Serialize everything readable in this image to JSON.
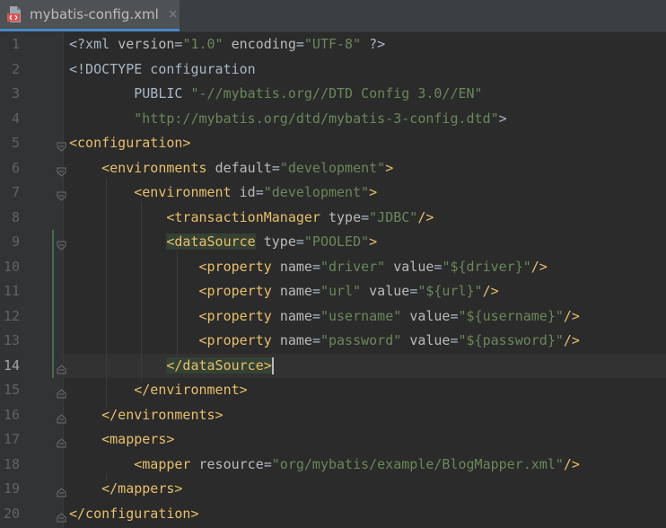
{
  "tab": {
    "title": "mybatis-config.xml",
    "close": "×"
  },
  "editor": {
    "current_line": 14,
    "lines": [
      {
        "n": "1",
        "t": [
          [
            "txt",
            "<?xml "
          ],
          [
            "attr",
            "version"
          ],
          [
            "txt",
            "="
          ],
          [
            "val",
            "\"1.0\""
          ],
          [
            "txt",
            " "
          ],
          [
            "attr",
            "encoding"
          ],
          [
            "txt",
            "="
          ],
          [
            "val",
            "\"UTF-8\""
          ],
          [
            "txt",
            " ?>"
          ]
        ]
      },
      {
        "n": "2",
        "t": [
          [
            "txt",
            "<!DOCTYPE configuration"
          ]
        ]
      },
      {
        "n": "3",
        "t": [
          [
            "txt",
            "        PUBLIC "
          ],
          [
            "val",
            "\"-//mybatis.org//DTD Config 3.0//EN\""
          ]
        ]
      },
      {
        "n": "4",
        "t": [
          [
            "txt",
            "        "
          ],
          [
            "val",
            "\"http://mybatis.org/dtd/mybatis-3-config.dtd\""
          ],
          [
            "txt",
            ">"
          ]
        ]
      },
      {
        "n": "5",
        "t": [
          [
            "tag",
            "<configuration>"
          ]
        ]
      },
      {
        "n": "6",
        "t": [
          [
            "txt",
            "    "
          ],
          [
            "tag",
            "<environments"
          ],
          [
            "txt",
            " "
          ],
          [
            "attr",
            "default"
          ],
          [
            "txt",
            "="
          ],
          [
            "val",
            "\"development\""
          ],
          [
            "tag",
            ">"
          ]
        ]
      },
      {
        "n": "7",
        "t": [
          [
            "txt",
            "        "
          ],
          [
            "tag",
            "<environment"
          ],
          [
            "txt",
            " "
          ],
          [
            "attr",
            "id"
          ],
          [
            "txt",
            "="
          ],
          [
            "val",
            "\"development\""
          ],
          [
            "tag",
            ">"
          ]
        ]
      },
      {
        "n": "8",
        "t": [
          [
            "txt",
            "            "
          ],
          [
            "tag",
            "<transactionManager"
          ],
          [
            "txt",
            " "
          ],
          [
            "attr",
            "type"
          ],
          [
            "txt",
            "="
          ],
          [
            "val",
            "\"JDBC\""
          ],
          [
            "tag",
            "/>"
          ]
        ]
      },
      {
        "n": "9",
        "t": [
          [
            "txt",
            "            "
          ],
          [
            "tagh",
            "<dataSource"
          ],
          [
            "txt",
            " "
          ],
          [
            "attr",
            "type"
          ],
          [
            "txt",
            "="
          ],
          [
            "val",
            "\"POOLED\""
          ],
          [
            "tag",
            ">"
          ]
        ]
      },
      {
        "n": "10",
        "t": [
          [
            "txt",
            "                "
          ],
          [
            "tag",
            "<property"
          ],
          [
            "txt",
            " "
          ],
          [
            "attr",
            "name"
          ],
          [
            "txt",
            "="
          ],
          [
            "val",
            "\"driver\""
          ],
          [
            "txt",
            " "
          ],
          [
            "attr",
            "value"
          ],
          [
            "txt",
            "="
          ],
          [
            "val",
            "\"${driver}\""
          ],
          [
            "tag",
            "/>"
          ]
        ]
      },
      {
        "n": "11",
        "t": [
          [
            "txt",
            "                "
          ],
          [
            "tag",
            "<property"
          ],
          [
            "txt",
            " "
          ],
          [
            "attr",
            "name"
          ],
          [
            "txt",
            "="
          ],
          [
            "val",
            "\"url\""
          ],
          [
            "txt",
            " "
          ],
          [
            "attr",
            "value"
          ],
          [
            "txt",
            "="
          ],
          [
            "val",
            "\"${url}\""
          ],
          [
            "tag",
            "/>"
          ]
        ]
      },
      {
        "n": "12",
        "t": [
          [
            "txt",
            "                "
          ],
          [
            "tag",
            "<property"
          ],
          [
            "txt",
            " "
          ],
          [
            "attr",
            "name"
          ],
          [
            "txt",
            "="
          ],
          [
            "val",
            "\"username\""
          ],
          [
            "txt",
            " "
          ],
          [
            "attr",
            "value"
          ],
          [
            "txt",
            "="
          ],
          [
            "val",
            "\"${username}\""
          ],
          [
            "tag",
            "/>"
          ]
        ]
      },
      {
        "n": "13",
        "t": [
          [
            "txt",
            "                "
          ],
          [
            "tag",
            "<property"
          ],
          [
            "txt",
            " "
          ],
          [
            "attr",
            "name"
          ],
          [
            "txt",
            "="
          ],
          [
            "val",
            "\"password\""
          ],
          [
            "txt",
            " "
          ],
          [
            "attr",
            "value"
          ],
          [
            "txt",
            "="
          ],
          [
            "val",
            "\"${password}\""
          ],
          [
            "tag",
            "/>"
          ]
        ]
      },
      {
        "n": "14",
        "t": [
          [
            "txt",
            "            "
          ],
          [
            "tagh",
            "</dataSource>"
          ],
          [
            "caret",
            ""
          ]
        ]
      },
      {
        "n": "15",
        "t": [
          [
            "txt",
            "        "
          ],
          [
            "tag",
            "</environment>"
          ]
        ]
      },
      {
        "n": "16",
        "t": [
          [
            "txt",
            "    "
          ],
          [
            "tag",
            "</environments>"
          ]
        ]
      },
      {
        "n": "17",
        "t": [
          [
            "txt",
            "    "
          ],
          [
            "tag",
            "<mappers>"
          ]
        ]
      },
      {
        "n": "18",
        "t": [
          [
            "txt",
            "        "
          ],
          [
            "tag",
            "<mapper"
          ],
          [
            "txt",
            " "
          ],
          [
            "attr",
            "resource"
          ],
          [
            "txt",
            "="
          ],
          [
            "val",
            "\"org/mybatis/example/BlogMapper.xml\""
          ],
          [
            "tag",
            "/>"
          ]
        ]
      },
      {
        "n": "19",
        "t": [
          [
            "txt",
            "    "
          ],
          [
            "tag",
            "</mappers>"
          ]
        ]
      },
      {
        "n": "20",
        "t": [
          [
            "tag",
            "</configuration>"
          ]
        ]
      }
    ],
    "fold_open_lines": [
      5,
      6,
      7,
      9
    ],
    "fold_close_lines": [
      14,
      15,
      16,
      17,
      19,
      20
    ]
  },
  "colors": {
    "tag": "#e8bf6a",
    "attr": "#bababa",
    "value": "#6a8759",
    "text": "#a9b7c6",
    "background": "#2b2b2b",
    "gutter": "#313335"
  }
}
